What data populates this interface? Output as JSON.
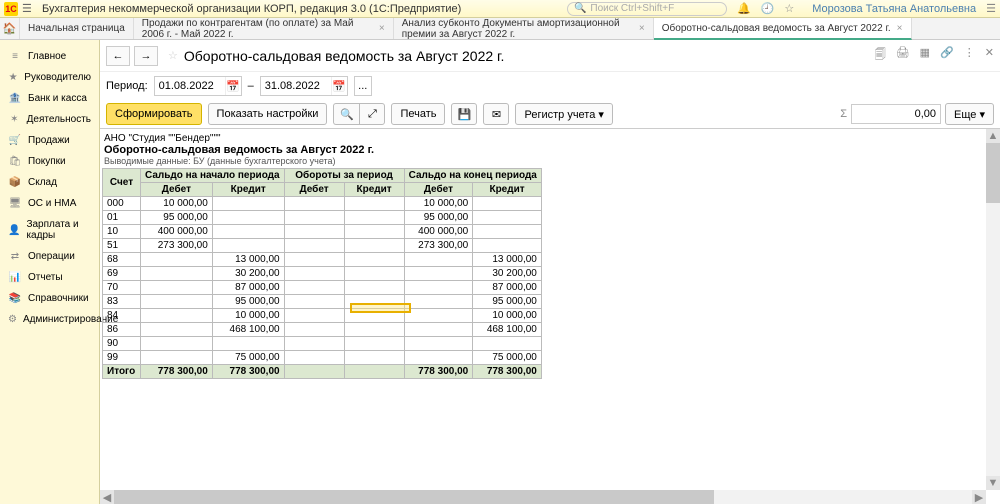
{
  "titlebar": {
    "logo": "1C",
    "title": "Бухгалтерия некоммерческой организации КОРП, редакция 3.0  (1С:Предприятие)",
    "search_placeholder": "Поиск Ctrl+Shift+F",
    "user": "Морозова Татьяна Анатольевна"
  },
  "tabs": [
    {
      "label": "Начальная страница",
      "closable": false
    },
    {
      "label": "Продажи по контрагентам (по оплате) за Май 2006 г. - Май 2022 г.",
      "closable": true
    },
    {
      "label": "Анализ субконто Документы амортизационной премии за Август 2022 г.",
      "closable": true
    },
    {
      "label": "Оборотно-сальдовая ведомость за Август 2022 г.",
      "closable": true,
      "active": true
    }
  ],
  "sidebar": {
    "items": [
      {
        "icon": "≡",
        "label": "Главное"
      },
      {
        "icon": "★",
        "label": "Руководителю"
      },
      {
        "icon": "🏦",
        "label": "Банк и касса"
      },
      {
        "icon": "✶",
        "label": "Деятельность"
      },
      {
        "icon": "🛒",
        "label": "Продажи"
      },
      {
        "icon": "🛍",
        "label": "Покупки"
      },
      {
        "icon": "📦",
        "label": "Склад"
      },
      {
        "icon": "🖥",
        "label": "ОС и НМА"
      },
      {
        "icon": "👤",
        "label": "Зарплата и кадры"
      },
      {
        "icon": "⇄",
        "label": "Операции"
      },
      {
        "icon": "📊",
        "label": "Отчеты"
      },
      {
        "icon": "📚",
        "label": "Справочники"
      },
      {
        "icon": "⚙",
        "label": "Администрирование"
      }
    ]
  },
  "page": {
    "title": "Оборотно-сальдовая ведомость за Август 2022 г.",
    "period_label": "Период:",
    "date_from": "01.08.2022",
    "date_sep": "–",
    "date_to": "31.08.2022",
    "more_btn": "..."
  },
  "toolbar": {
    "form": "Сформировать",
    "show_settings": "Показать настройки",
    "find_ico": "🔍",
    "expand_ico": "⤢",
    "print": "Печать",
    "save_ico": "💾",
    "mail_ico": "✉",
    "register": "Регистр учета ▾",
    "sum_value": "0,00",
    "more": "Еще ▾"
  },
  "report": {
    "org": "АНО \"Студия \"\"Бендер\"\"\"",
    "title": "Оборотно-сальдовая ведомость за Август 2022 г.",
    "sub": "Выводимые данные:   БУ (данные бухгалтерского учета)",
    "headers": {
      "acct": "Счет",
      "open": "Сальдо на начало периода",
      "turn": "Обороты за период",
      "close": "Сальдо на конец периода",
      "debit": "Дебет",
      "credit": "Кредит"
    },
    "rows": [
      {
        "a": "000",
        "od": "10 000,00",
        "oc": "",
        "td": "",
        "tc": "",
        "cd": "10 000,00",
        "cc": ""
      },
      {
        "a": "01",
        "od": "95 000,00",
        "oc": "",
        "td": "",
        "tc": "",
        "cd": "95 000,00",
        "cc": ""
      },
      {
        "a": "10",
        "od": "400 000,00",
        "oc": "",
        "td": "",
        "tc": "",
        "cd": "400 000,00",
        "cc": ""
      },
      {
        "a": "51",
        "od": "273 300,00",
        "oc": "",
        "td": "",
        "tc": "",
        "cd": "273 300,00",
        "cc": ""
      },
      {
        "a": "68",
        "od": "",
        "oc": "13 000,00",
        "td": "",
        "tc": "",
        "cd": "",
        "cc": "13 000,00"
      },
      {
        "a": "69",
        "od": "",
        "oc": "30 200,00",
        "td": "",
        "tc": "",
        "cd": "",
        "cc": "30 200,00"
      },
      {
        "a": "70",
        "od": "",
        "oc": "87 000,00",
        "td": "",
        "tc": "",
        "cd": "",
        "cc": "87 000,00"
      },
      {
        "a": "83",
        "od": "",
        "oc": "95 000,00",
        "td": "",
        "tc": "",
        "cd": "",
        "cc": "95 000,00"
      },
      {
        "a": "84",
        "od": "",
        "oc": "10 000,00",
        "td": "",
        "tc": "",
        "cd": "",
        "cc": "10 000,00"
      },
      {
        "a": "86",
        "od": "",
        "oc": "468 100,00",
        "td": "",
        "tc": "",
        "cd": "",
        "cc": "468 100,00"
      },
      {
        "a": "90",
        "od": "",
        "oc": "",
        "td": "",
        "tc": "",
        "cd": "",
        "cc": ""
      },
      {
        "a": "99",
        "od": "",
        "oc": "75 000,00",
        "td": "",
        "tc": "",
        "cd": "",
        "cc": "75 000,00"
      }
    ],
    "total": {
      "label": "Итого",
      "od": "778 300,00",
      "oc": "778 300,00",
      "td": "",
      "tc": "",
      "cd": "778 300,00",
      "cc": "778 300,00"
    }
  }
}
